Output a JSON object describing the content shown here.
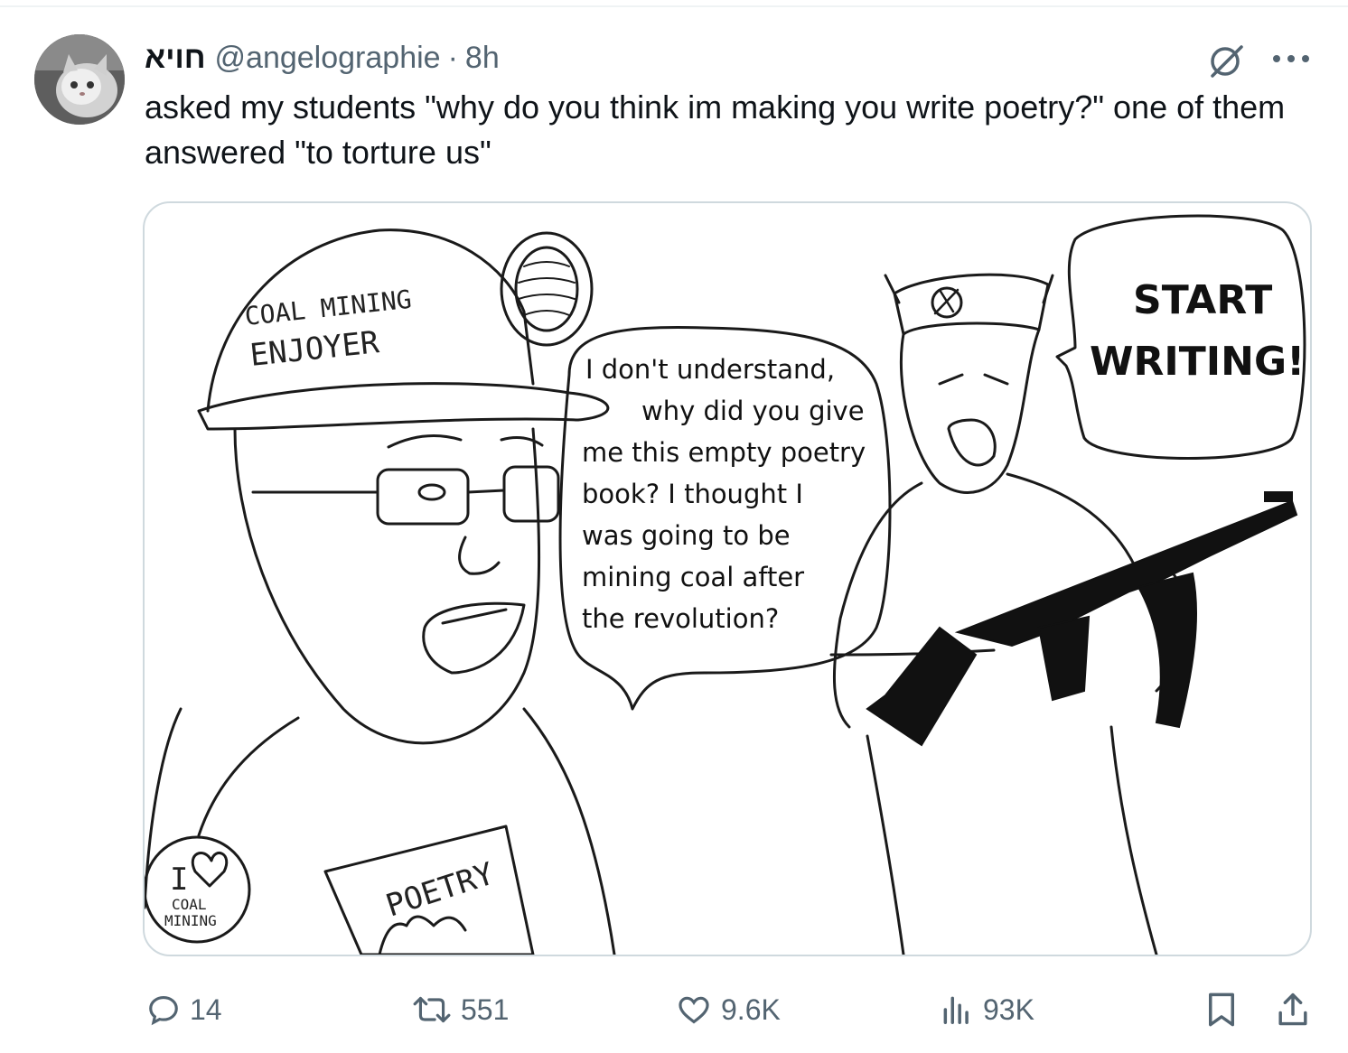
{
  "tweet": {
    "display_name": "חויא",
    "handle": "@angelographie",
    "separator": "·",
    "time": "8h",
    "text": "asked my students \"why do you think im making you write poetry?\" one of them answered \"to torture us\""
  },
  "icons": {
    "grok": "grok-icon",
    "more": "more-icon",
    "reply": "reply-icon",
    "retweet": "retweet-icon",
    "like": "heart-icon",
    "views": "views-icon",
    "bookmark": "bookmark-icon",
    "share": "share-icon"
  },
  "media": {
    "hat_text_line1": "COAL MINING",
    "hat_text_line2": "ENJOYER",
    "bubble_left_lines": [
      "I don't understand,",
      "why did you give",
      "me this empty poetry",
      "book? I thought I",
      "was going to be",
      "mining coal after",
      "the revolution?"
    ],
    "bubble_right_lines": [
      "START",
      "WRITING!"
    ],
    "badge_line1": "I",
    "badge_line2": "COAL",
    "badge_line3": "MINING",
    "book_text": "POETRY"
  },
  "actions": {
    "replies": "14",
    "retweets": "551",
    "likes": "9.6K",
    "views": "93K"
  },
  "colors": {
    "text_primary": "#0f1419",
    "text_secondary": "#536471",
    "border": "#cfd9de"
  }
}
